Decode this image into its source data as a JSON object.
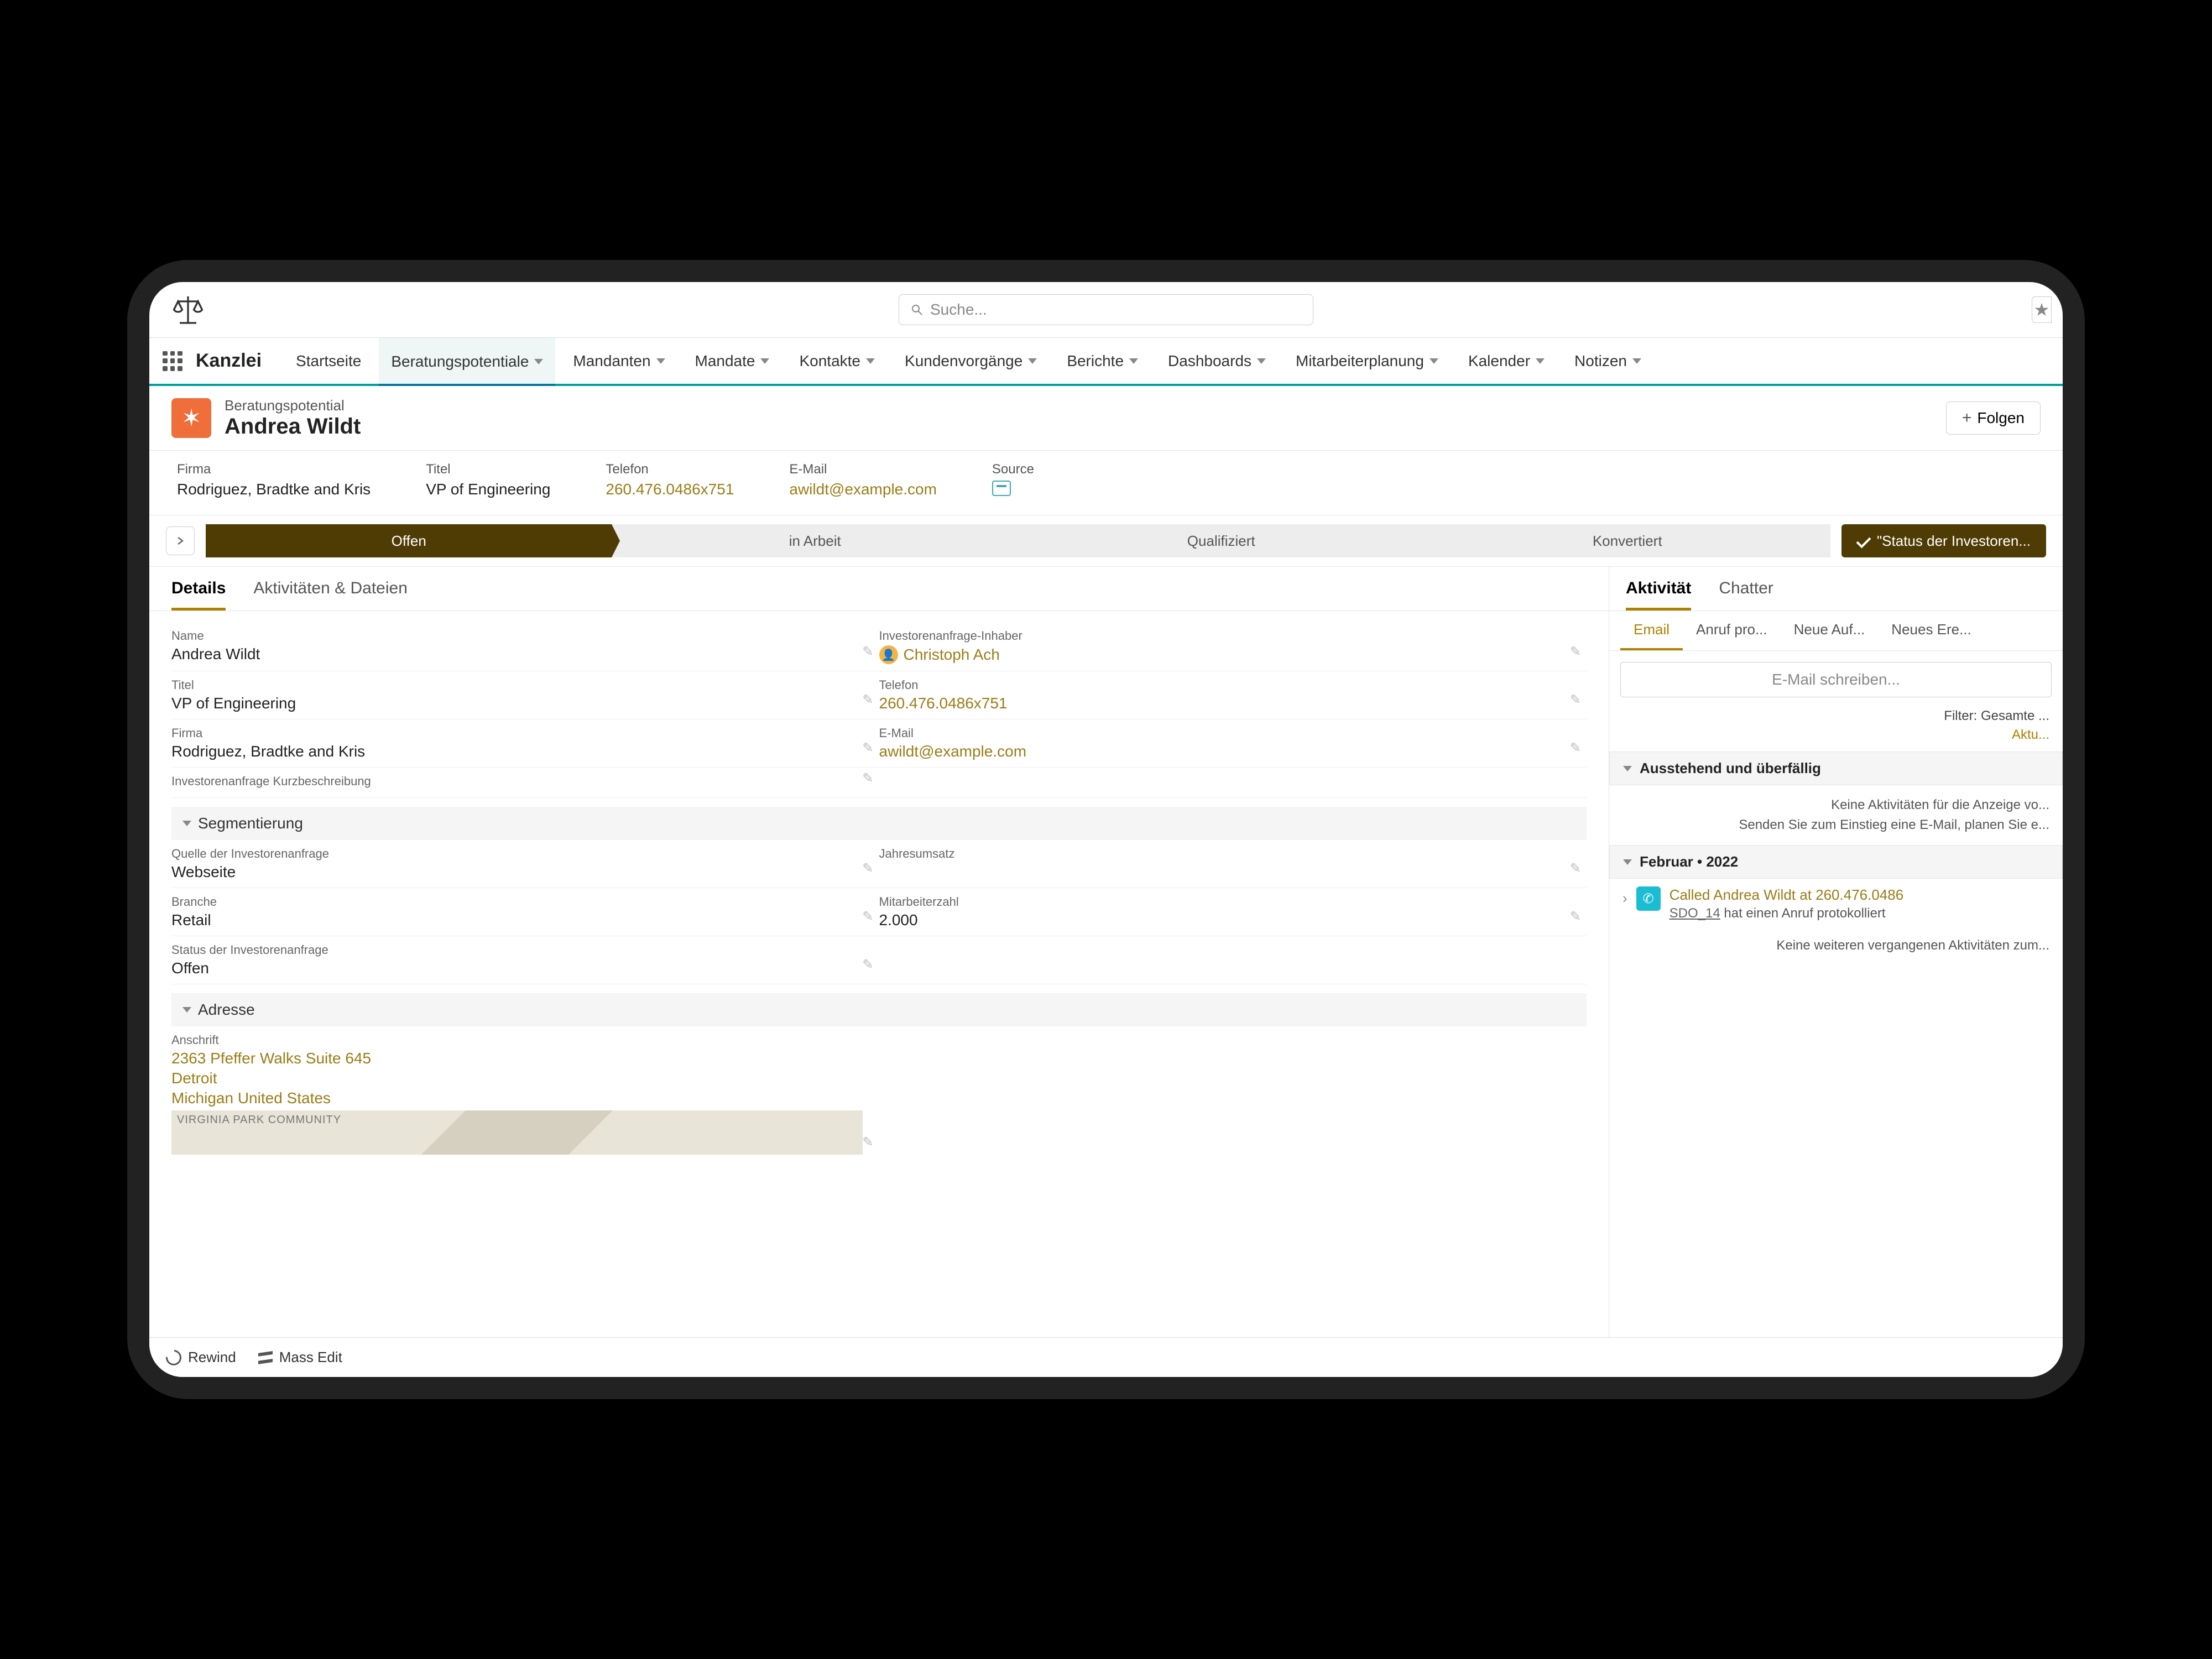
{
  "search": {
    "placeholder": "Suche..."
  },
  "app_name": "Kanzlei",
  "nav": {
    "items": [
      {
        "label": "Startseite"
      },
      {
        "label": "Beratungspotentiale",
        "active": true
      },
      {
        "label": "Mandanten"
      },
      {
        "label": "Mandate"
      },
      {
        "label": "Kontakte"
      },
      {
        "label": "Kundenvorgänge"
      },
      {
        "label": "Berichte"
      },
      {
        "label": "Dashboards"
      },
      {
        "label": "Mitarbeiterplanung"
      },
      {
        "label": "Kalender"
      },
      {
        "label": "Notizen"
      }
    ]
  },
  "record": {
    "type": "Beratungspotential",
    "title": "Andrea Wildt",
    "follow": "Folgen"
  },
  "summary": {
    "firma_label": "Firma",
    "firma_value": "Rodriguez, Bradtke and Kris",
    "titel_label": "Titel",
    "titel_value": "VP of Engineering",
    "telefon_label": "Telefon",
    "telefon_value": "260.476.0486x751",
    "email_label": "E-Mail",
    "email_value": "awildt@example.com",
    "source_label": "Source"
  },
  "path": {
    "stages": [
      "Offen",
      "in Arbeit",
      "Qualifiziert",
      "Konvertiert"
    ],
    "complete": "\"Status der Investoren..."
  },
  "tabs": {
    "details": "Details",
    "activities": "Aktivitäten & Dateien"
  },
  "details": {
    "name_label": "Name",
    "name_value": "Andrea Wildt",
    "owner_label": "Investorenanfrage-Inhaber",
    "owner_value": "Christoph Ach",
    "titel_label": "Titel",
    "titel_value": "VP of Engineering",
    "telefon_label": "Telefon",
    "telefon_value": "260.476.0486x751",
    "firma_label": "Firma",
    "firma_value": "Rodriguez, Bradtke and Kris",
    "email_label": "E-Mail",
    "email_value": "awildt@example.com",
    "desc_label": "Investorenanfrage Kurzbeschreibung",
    "seg_header": "Segmentierung",
    "source_label": "Quelle der Investorenanfrage",
    "source_value": "Webseite",
    "revenue_label": "Jahresumsatz",
    "branche_label": "Branche",
    "branche_value": "Retail",
    "employees_label": "Mitarbeiterzahl",
    "employees_value": "2.000",
    "status_label": "Status der Investorenanfrage",
    "status_value": "Offen",
    "addr_header": "Adresse",
    "addr_label": "Anschrift",
    "addr_line1": "2363 Pfeffer Walks Suite 645",
    "addr_line2": "Detroit",
    "addr_line3": "Michigan United States",
    "map_text": "VIRGINIA PARK COMMUNITY"
  },
  "right_tabs": {
    "activity": "Aktivität",
    "chatter": "Chatter"
  },
  "activity_subtabs": [
    "Email",
    "Anruf pro...",
    "Neue Auf...",
    "Neues Ere..."
  ],
  "compose_placeholder": "E-Mail schreiben...",
  "filter_text": "Filter: Gesamte ...",
  "refresh_text": "Aktu...",
  "upcoming_header": "Ausstehend und überfällig",
  "empty1": "Keine Aktivitäten für die Anzeige vo...",
  "empty2": "Senden Sie zum Einstieg eine E-Mail, planen Sie e...",
  "month_header": "Februar • 2022",
  "timeline": {
    "title": "Called Andrea Wildt at 260.476.0486",
    "sub_user": "SDO_14",
    "sub_text": " hat einen Anruf protokolliert"
  },
  "more_past": "Keine weiteren vergangenen Aktivitäten zum...",
  "bottom": {
    "rewind": "Rewind",
    "mass_edit": "Mass Edit"
  }
}
